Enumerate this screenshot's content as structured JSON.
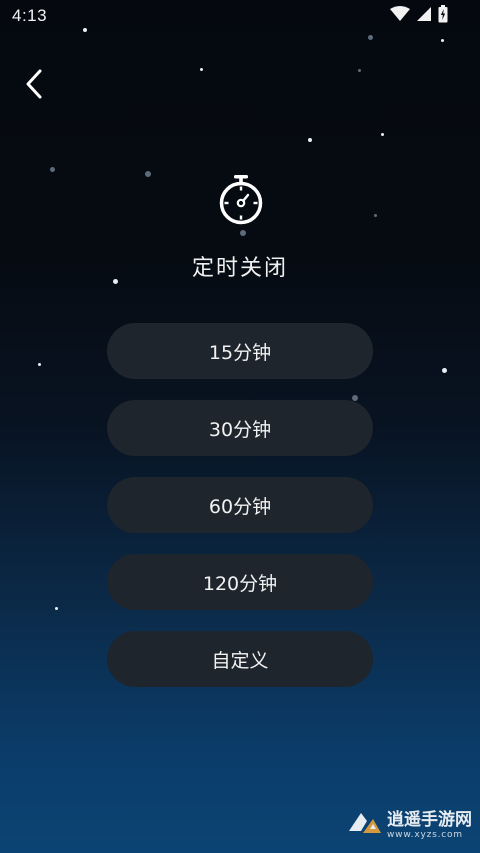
{
  "status_bar": {
    "time": "4:13",
    "icons": [
      "wifi-icon",
      "cell-signal-icon",
      "battery-charging-icon"
    ]
  },
  "nav": {
    "back_icon": "chevron-left-icon"
  },
  "header": {
    "icon": "stopwatch-icon",
    "title": "定时关闭"
  },
  "options": [
    {
      "label": "15分钟"
    },
    {
      "label": "30分钟"
    },
    {
      "label": "60分钟"
    },
    {
      "label": "120分钟"
    },
    {
      "label": "自定义"
    }
  ],
  "watermark": {
    "name": "逍遥手游网",
    "url": "www.xyzs.com"
  },
  "colors": {
    "background_top": "#05090f",
    "background_bottom": "#0b4474",
    "button_bg": "#1f252d",
    "text": "#f2f2f2"
  }
}
